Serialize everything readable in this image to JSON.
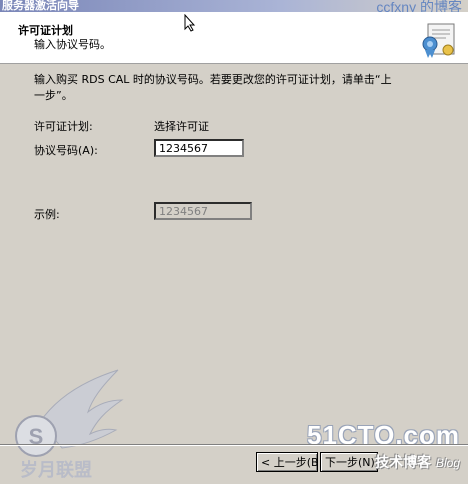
{
  "window": {
    "title": "服务器激活向导",
    "watermark_top": "ccfxny 的博客"
  },
  "header": {
    "title": "许可证计划",
    "subtitle": "输入协议号码。"
  },
  "body": {
    "instruction": "输入购买 RDS CAL 时的协议号码。若要更改您的许可证计划，请单击“上一步”。",
    "license_plan_label": "许可证计划:",
    "license_plan_value": "选择许可证",
    "agreement_label": "协议号码(A):",
    "agreement_value": "1234567",
    "example_label": "示例:",
    "example_value": "1234567"
  },
  "buttons": {
    "back_label": "< 上一步(B)",
    "next_label": "下一步(N)"
  },
  "watermarks": {
    "logo_text": "岁月联盟",
    "site": "51CTO.com",
    "tech_text": "技术博客",
    "blog_text": "Blog"
  },
  "colors": {
    "dialog_bg": "#d4d0c8",
    "header_bg": "#ffffff",
    "title_accent": "#5a7fc0"
  }
}
